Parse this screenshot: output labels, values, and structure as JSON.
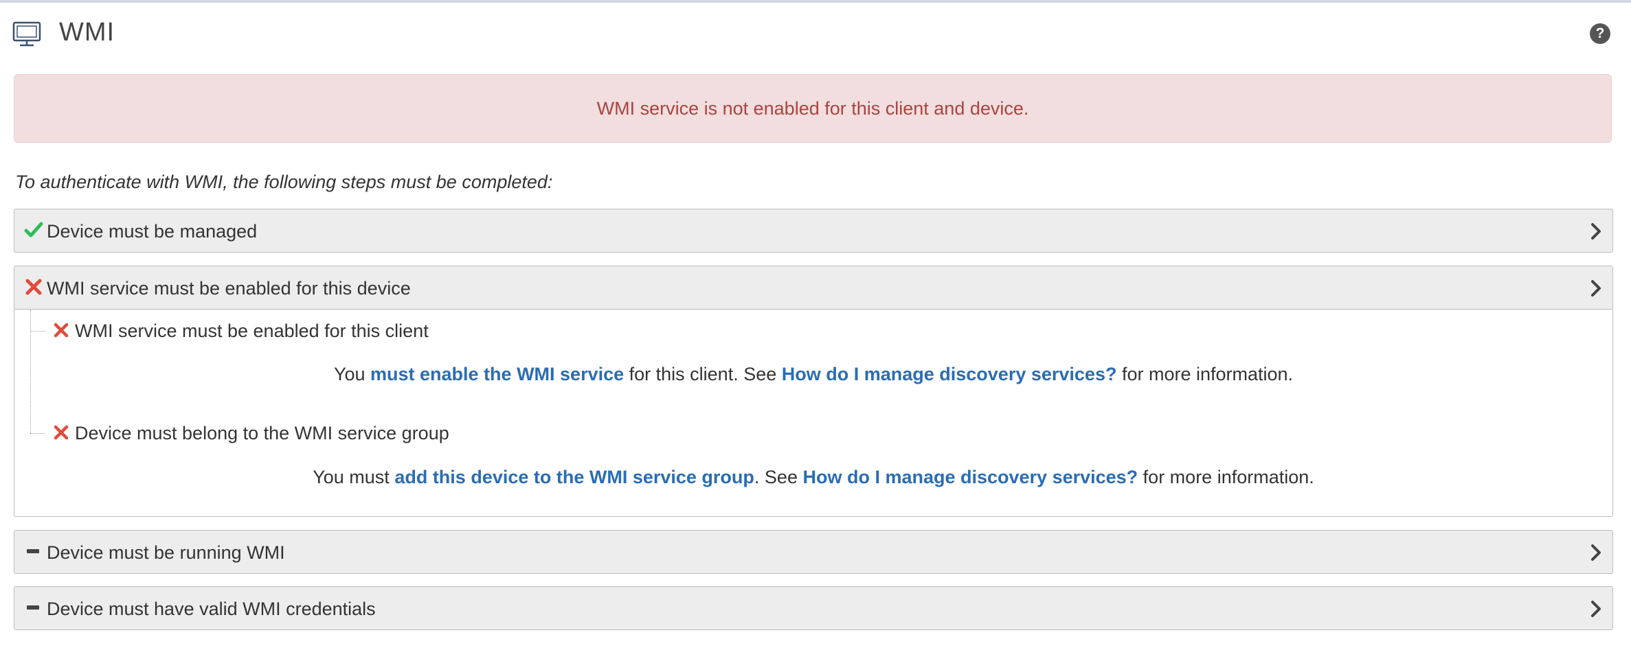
{
  "header": {
    "title": "WMI",
    "icon": "monitor-icon",
    "help_icon": "help-icon",
    "help_glyph": "?"
  },
  "alert": {
    "text": "WMI service is not enabled for this client and device."
  },
  "intro": "To authenticate with WMI, the following steps must be completed:",
  "steps": [
    {
      "label": "Device must be managed",
      "status": "check"
    },
    {
      "label": "WMI service must be enabled for this device",
      "status": "cross",
      "expanded": true,
      "substeps": [
        {
          "label": "WMI service must be enabled for this client",
          "status": "cross",
          "description": {
            "t1": "You ",
            "link1": "must enable the WMI service",
            "t2": " for this client. See ",
            "link2": "How do I manage discovery services?",
            "t3": " for more information."
          }
        },
        {
          "label": "Device must belong to the WMI service group",
          "status": "cross",
          "description": {
            "t1": "You must ",
            "link1": "add this device to the WMI service group",
            "t2": ". See ",
            "link2": "How do I manage discovery services?",
            "t3": " for more information."
          }
        }
      ]
    },
    {
      "label": "Device must be running WMI",
      "status": "dash"
    },
    {
      "label": "Device must have valid WMI credentials",
      "status": "dash"
    }
  ],
  "colors": {
    "check": "#2ebd59",
    "cross": "#e04b3c",
    "dash": "#444444",
    "link": "#2a6db3",
    "alert_text": "#a94442",
    "alert_bg": "#f2dede"
  }
}
